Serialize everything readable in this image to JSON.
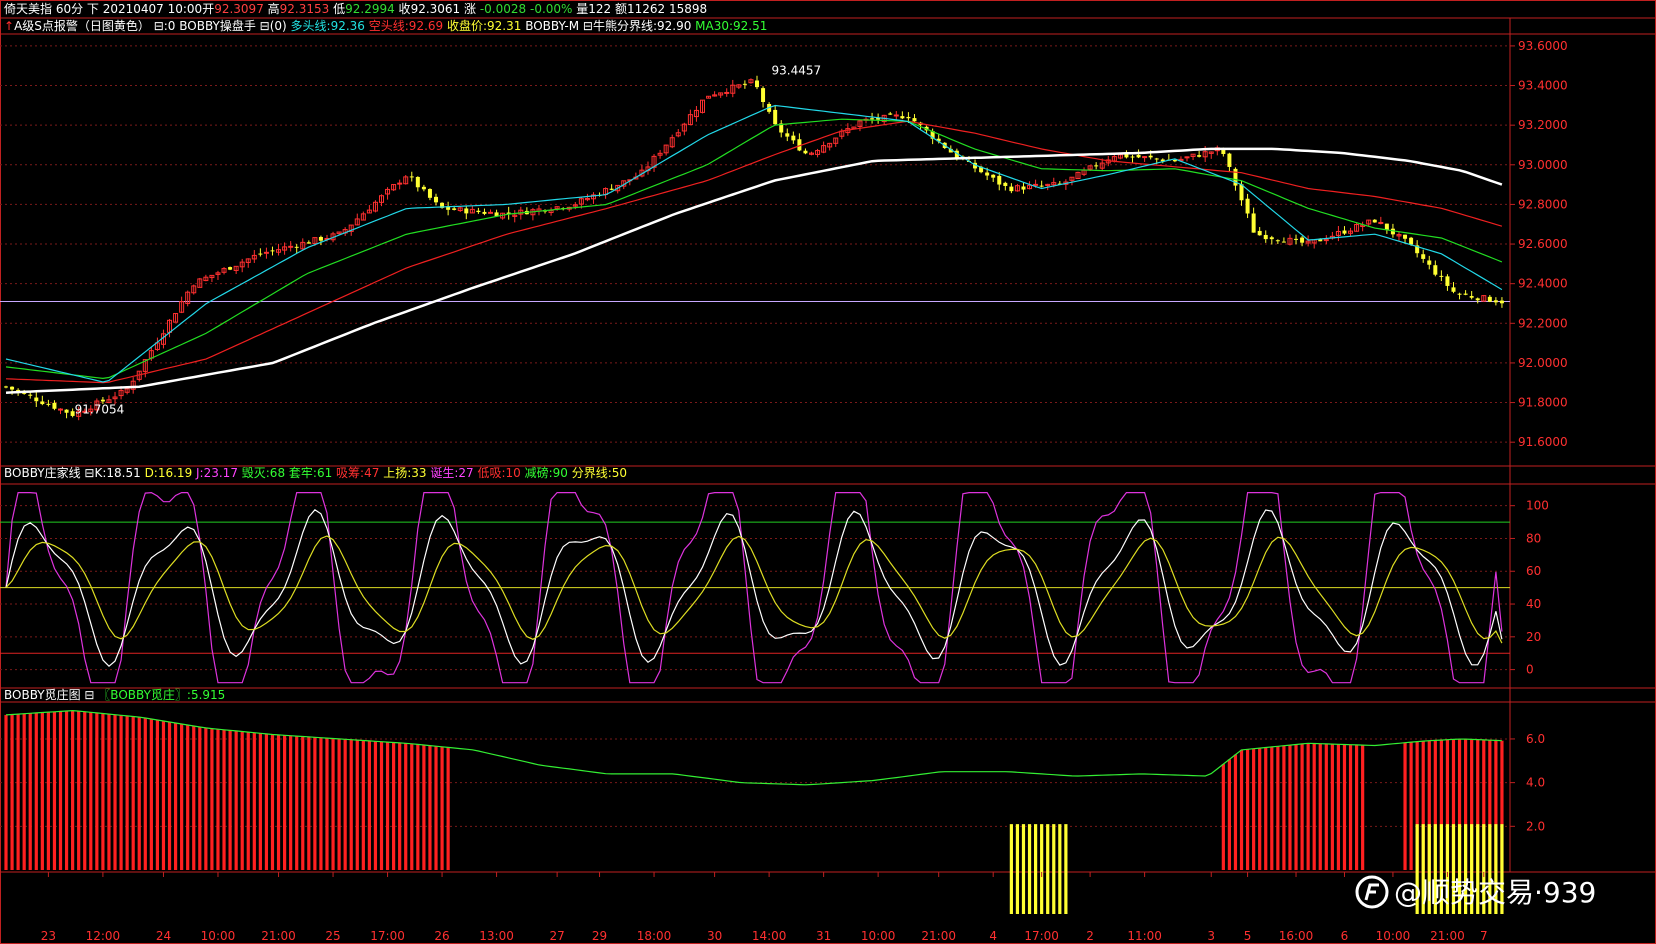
{
  "header": {
    "line1": [
      {
        "text": "倚天美指 60分 下 20210407 10:00开",
        "color": "#ffffff"
      },
      {
        "text": "92.3097",
        "color": "#ff4040"
      },
      {
        "text": " 高",
        "color": "#ffffff"
      },
      {
        "text": "92.3153",
        "color": "#ff4040"
      },
      {
        "text": " 低",
        "color": "#ffffff"
      },
      {
        "text": "92.2994",
        "color": "#33dd33"
      },
      {
        "text": " 收",
        "color": "#ffffff"
      },
      {
        "text": "92.3061",
        "color": "#ffffff"
      },
      {
        "text": " 涨 ",
        "color": "#ffffff"
      },
      {
        "text": "-0.0028",
        "color": "#33dd33"
      },
      {
        "text": " ",
        "color": "#ffffff"
      },
      {
        "text": "-0.00%",
        "color": "#33dd33"
      },
      {
        "text": " 量122 额11262 15898",
        "color": "#ffffff"
      }
    ],
    "line2": [
      {
        "text": "A级S点报警（日图黄色） ⊟:0  BOBBY操盘手 ⊟(0) ",
        "color": "#ffffff"
      },
      {
        "text": "多头线:92.36",
        "color": "#22e0e0"
      },
      {
        "text": " 空头线:92.69",
        "color": "#ff3030"
      },
      {
        "text": " 收盘价:92.31",
        "color": "#ffff33"
      },
      {
        "text": " BOBBY-M ⊟牛熊分界线:92.90",
        "color": "#ffffff"
      },
      {
        "text": " MA30:92.51",
        "color": "#33ff33"
      }
    ]
  },
  "sub1_header": [
    {
      "text": "BOBBY庄家线 ⊟K:18.51",
      "color": "#ffffff"
    },
    {
      "text": " D:16.19",
      "color": "#ffff33"
    },
    {
      "text": " J:23.17",
      "color": "#ff44ff"
    },
    {
      "text": " 毁灭:68",
      "color": "#33ff33"
    },
    {
      "text": "   套牢:61",
      "color": "#33ff33"
    },
    {
      "text": "    吸筹:47",
      "color": "#ff3030"
    },
    {
      "text": "    上扬:33",
      "color": "#ffff33"
    },
    {
      "text": "    诞生:27",
      "color": "#ff44ff"
    },
    {
      "text": "    低吸:10",
      "color": "#ff3030"
    },
    {
      "text": " 减磅:90",
      "color": "#33ff33"
    },
    {
      "text": " 分界线:50",
      "color": "#ffff33"
    }
  ],
  "sub2_header": [
    {
      "text": "BOBBY觅庄图 ⊟ ",
      "color": "#ffffff"
    },
    {
      "text": "〖BOBBY觅庄〗:5.915",
      "color": "#33ff33"
    }
  ],
  "chart_data": [
    {
      "type": "candlestick",
      "name": "main",
      "ylim": [
        91.5,
        93.65
      ],
      "yticks": [
        "93.6000",
        "93.4000",
        "93.2000",
        "93.0000",
        "92.8000",
        "92.6000",
        "92.4000",
        "92.2000",
        "92.0000",
        "91.8000",
        "91.6000"
      ],
      "annotations": [
        {
          "text": "93.4457",
          "value": 93.4457
        },
        {
          "text": "91.7054",
          "value": 91.7054
        }
      ],
      "close_level": 92.31,
      "anchors_close": [
        [
          0,
          91.88
        ],
        [
          10,
          91.74
        ],
        [
          18,
          91.86
        ],
        [
          28,
          92.4
        ],
        [
          38,
          92.55
        ],
        [
          50,
          92.65
        ],
        [
          60,
          92.95
        ],
        [
          65,
          92.78
        ],
        [
          75,
          92.75
        ],
        [
          85,
          92.8
        ],
        [
          95,
          92.95
        ],
        [
          105,
          93.35
        ],
        [
          112,
          93.42
        ],
        [
          115,
          93.2
        ],
        [
          120,
          93.05
        ],
        [
          128,
          93.22
        ],
        [
          135,
          93.25
        ],
        [
          142,
          93.05
        ],
        [
          150,
          92.88
        ],
        [
          158,
          92.9
        ],
        [
          166,
          93.05
        ],
        [
          175,
          93.02
        ],
        [
          182,
          93.08
        ],
        [
          187,
          92.65
        ],
        [
          195,
          92.6
        ],
        [
          205,
          92.72
        ],
        [
          210,
          92.6
        ],
        [
          217,
          92.35
        ],
        [
          224,
          92.31
        ]
      ],
      "anchors_ma1": [
        [
          0,
          92.02
        ],
        [
          15,
          91.9
        ],
        [
          30,
          92.3
        ],
        [
          45,
          92.58
        ],
        [
          60,
          92.78
        ],
        [
          75,
          92.8
        ],
        [
          90,
          92.85
        ],
        [
          105,
          93.15
        ],
        [
          115,
          93.3
        ],
        [
          125,
          93.26
        ],
        [
          135,
          93.22
        ],
        [
          145,
          93.0
        ],
        [
          155,
          92.88
        ],
        [
          165,
          92.95
        ],
        [
          175,
          93.03
        ],
        [
          185,
          92.9
        ],
        [
          195,
          92.62
        ],
        [
          205,
          92.65
        ],
        [
          215,
          92.55
        ],
        [
          224,
          92.37
        ]
      ],
      "anchors_ma2": [
        [
          0,
          91.98
        ],
        [
          15,
          91.92
        ],
        [
          30,
          92.15
        ],
        [
          45,
          92.45
        ],
        [
          60,
          92.65
        ],
        [
          75,
          92.75
        ],
        [
          90,
          92.8
        ],
        [
          105,
          93.0
        ],
        [
          115,
          93.2
        ],
        [
          125,
          93.23
        ],
        [
          135,
          93.22
        ],
        [
          145,
          93.08
        ],
        [
          155,
          92.98
        ],
        [
          165,
          92.97
        ],
        [
          175,
          92.98
        ],
        [
          185,
          92.92
        ],
        [
          195,
          92.78
        ],
        [
          205,
          92.68
        ],
        [
          215,
          92.63
        ],
        [
          224,
          92.51
        ]
      ],
      "anchors_ma3": [
        [
          0,
          91.92
        ],
        [
          15,
          91.9
        ],
        [
          30,
          92.02
        ],
        [
          45,
          92.25
        ],
        [
          60,
          92.48
        ],
        [
          75,
          92.65
        ],
        [
          90,
          92.78
        ],
        [
          105,
          92.92
        ],
        [
          115,
          93.05
        ],
        [
          125,
          93.17
        ],
        [
          135,
          93.22
        ],
        [
          145,
          93.16
        ],
        [
          155,
          93.08
        ],
        [
          165,
          93.02
        ],
        [
          175,
          92.99
        ],
        [
          185,
          92.96
        ],
        [
          195,
          92.88
        ],
        [
          205,
          92.84
        ],
        [
          215,
          92.78
        ],
        [
          224,
          92.69
        ]
      ],
      "anchors_ma4": [
        [
          0,
          91.85
        ],
        [
          20,
          91.88
        ],
        [
          40,
          92.0
        ],
        [
          55,
          92.2
        ],
        [
          70,
          92.38
        ],
        [
          85,
          92.55
        ],
        [
          100,
          92.75
        ],
        [
          115,
          92.92
        ],
        [
          130,
          93.02
        ],
        [
          140,
          93.03
        ],
        [
          160,
          93.05
        ],
        [
          170,
          93.06
        ],
        [
          180,
          93.08
        ],
        [
          190,
          93.08
        ],
        [
          200,
          93.06
        ],
        [
          210,
          93.02
        ],
        [
          218,
          92.97
        ],
        [
          224,
          92.9
        ]
      ]
    },
    {
      "type": "line",
      "name": "sub1",
      "ylim": [
        -10,
        112
      ],
      "yticks": [
        100,
        80,
        60,
        40,
        20,
        0
      ],
      "levels": {
        "top": 90,
        "mid": 50,
        "low": 10
      },
      "series": [
        {
          "key": "K",
          "value": 18.51
        },
        {
          "key": "D",
          "value": 16.19
        },
        {
          "key": "J",
          "value": 23.17
        }
      ]
    },
    {
      "type": "bar",
      "name": "sub2",
      "ylim": [
        0,
        7.6
      ],
      "yticks": [
        "6.0",
        "4.0",
        "2.0"
      ],
      "series": [
        {
          "key": "BOBBY觅庄",
          "value": 5.915
        }
      ],
      "anchors_line": [
        [
          0,
          7.1
        ],
        [
          10,
          7.3
        ],
        [
          20,
          7.0
        ],
        [
          30,
          6.5
        ],
        [
          40,
          6.2
        ],
        [
          50,
          6.0
        ],
        [
          60,
          5.8
        ],
        [
          70,
          5.5
        ],
        [
          80,
          4.8
        ],
        [
          90,
          4.4
        ],
        [
          100,
          4.4
        ],
        [
          110,
          4.0
        ],
        [
          120,
          3.9
        ],
        [
          130,
          4.1
        ],
        [
          140,
          4.5
        ],
        [
          150,
          4.5
        ],
        [
          160,
          4.3
        ],
        [
          170,
          4.4
        ],
        [
          180,
          4.3
        ],
        [
          185,
          5.5
        ],
        [
          195,
          5.8
        ],
        [
          205,
          5.7
        ],
        [
          212,
          5.9
        ],
        [
          218,
          6.0
        ],
        [
          224,
          5.92
        ]
      ],
      "red_ranges": [
        [
          0,
          67
        ],
        [
          182,
          204
        ],
        [
          209,
          224
        ]
      ],
      "yellow_ranges": [
        [
          150,
          159
        ],
        [
          211,
          224
        ]
      ],
      "yellow_level": 2.1
    }
  ],
  "xaxis_labels": [
    {
      "i": 7,
      "text": "23"
    },
    {
      "i": 16,
      "text": "12:00"
    },
    {
      "i": 26,
      "text": "24"
    },
    {
      "i": 35,
      "text": "10:00"
    },
    {
      "i": 45,
      "text": "21:00"
    },
    {
      "i": 54,
      "text": "25"
    },
    {
      "i": 63,
      "text": "17:00"
    },
    {
      "i": 72,
      "text": "26"
    },
    {
      "i": 81,
      "text": "13:00"
    },
    {
      "i": 91,
      "text": "27"
    },
    {
      "i": 98,
      "text": "29"
    },
    {
      "i": 107,
      "text": "18:00"
    },
    {
      "i": 117,
      "text": "30"
    },
    {
      "i": 126,
      "text": "14:00"
    },
    {
      "i": 135,
      "text": "31"
    },
    {
      "i": 144,
      "text": "10:00"
    },
    {
      "i": 154,
      "text": "21:00"
    },
    {
      "i": 163,
      "text": "4"
    },
    {
      "i": 171,
      "text": "17:00"
    },
    {
      "i": 179,
      "text": "2"
    },
    {
      "i": 188,
      "text": "11:00"
    },
    {
      "i": 199,
      "text": "3"
    },
    {
      "i": 205,
      "text": "5"
    },
    {
      "i": 213,
      "text": "16:00"
    },
    {
      "i": 221,
      "text": "6"
    },
    {
      "i": 229,
      "text": "10:00"
    },
    {
      "i": 238,
      "text": "21:00"
    },
    {
      "i": 244,
      "text": "7"
    }
  ],
  "colors": {
    "up": "#ff3030",
    "down": "#ffff33",
    "grid": "#7a1a1a",
    "axis": "#c02020",
    "ma1": "#22d8e8",
    "ma2": "#22dd22",
    "ma3": "#ee2020",
    "ma4": "#ffffff",
    "K": "#ffffff",
    "D": "#dddd22",
    "J": "#dd33dd",
    "sub_line": "#33ee33"
  },
  "watermark": {
    "text": "@顺势交易·939",
    "icon": "logo-icon"
  }
}
